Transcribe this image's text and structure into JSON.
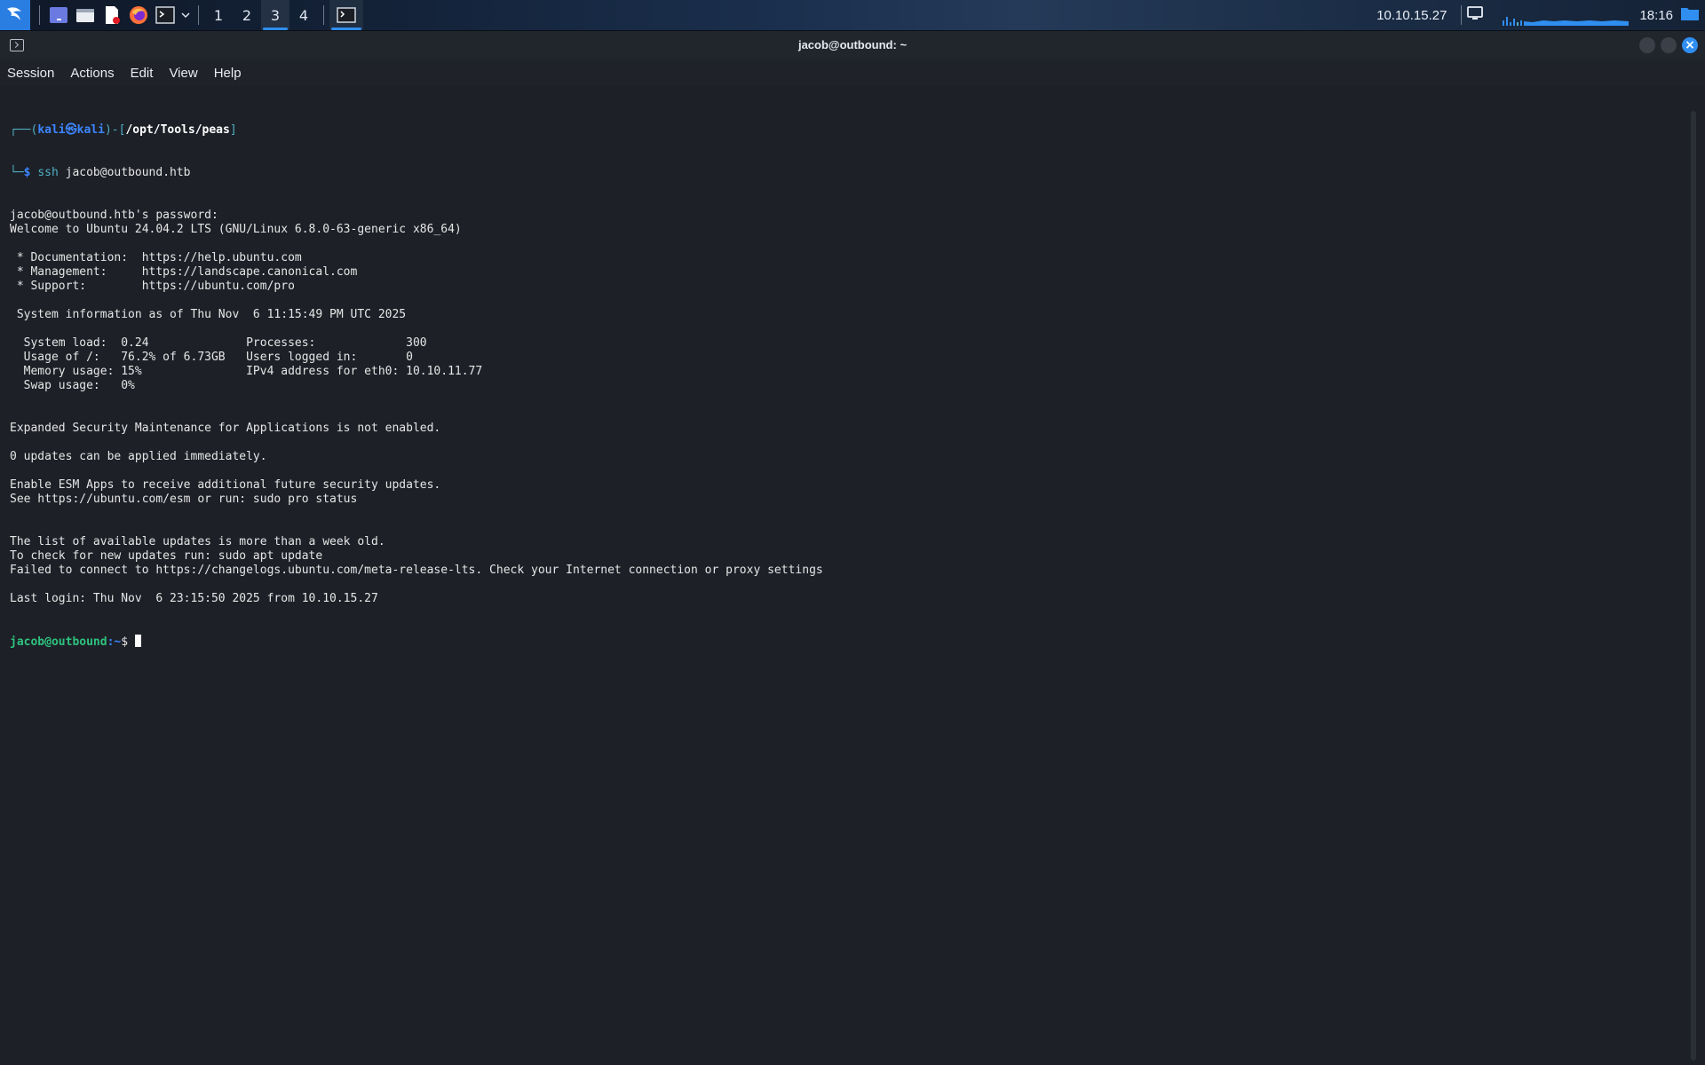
{
  "taskbar": {
    "workspaces": [
      "1",
      "2",
      "3",
      "4"
    ],
    "active_workspace": "3",
    "ip": "10.10.15.27",
    "clock": "18:16",
    "icons": [
      "kali-menu-icon",
      "desktop-icon",
      "file-manager-icon",
      "text-editor-icon",
      "firefox-icon",
      "terminal-icon",
      "chevron-down-icon"
    ]
  },
  "window": {
    "title": "jacob@outbound: ~",
    "menu": [
      "Session",
      "Actions",
      "Edit",
      "View",
      "Help"
    ]
  },
  "terminal": {
    "prompt_user": "kali",
    "prompt_at": "㉿",
    "prompt_host": "kali",
    "prompt_path": "/opt/Tools/peas",
    "command_name": "ssh",
    "command_args": " jacob@outbound.htb",
    "lines": [
      "jacob@outbound.htb's password:",
      "Welcome to Ubuntu 24.04.2 LTS (GNU/Linux 6.8.0-63-generic x86_64)",
      "",
      " * Documentation:  https://help.ubuntu.com",
      " * Management:     https://landscape.canonical.com",
      " * Support:        https://ubuntu.com/pro",
      "",
      " System information as of Thu Nov  6 11:15:49 PM UTC 2025",
      "",
      "  System load:  0.24              Processes:             300",
      "  Usage of /:   76.2% of 6.73GB   Users logged in:       0",
      "  Memory usage: 15%               IPv4 address for eth0: 10.10.11.77",
      "  Swap usage:   0%",
      "",
      "",
      "Expanded Security Maintenance for Applications is not enabled.",
      "",
      "0 updates can be applied immediately.",
      "",
      "Enable ESM Apps to receive additional future security updates.",
      "See https://ubuntu.com/esm or run: sudo pro status",
      "",
      "",
      "The list of available updates is more than a week old.",
      "To check for new updates run: sudo apt update",
      "Failed to connect to https://changelogs.ubuntu.com/meta-release-lts. Check your Internet connection or proxy settings",
      "",
      "Last login: Thu Nov  6 23:15:50 2025 from 10.10.15.27"
    ],
    "final_prompt_user": "jacob@outbound",
    "final_prompt_path": ":~",
    "final_prompt_sign": "$ "
  },
  "colors": {
    "accent": "#2f8ef0",
    "terminal_bg": "#1d2027",
    "prompt_green": "#2ec27e",
    "prompt_blue": "#3c86ff"
  }
}
